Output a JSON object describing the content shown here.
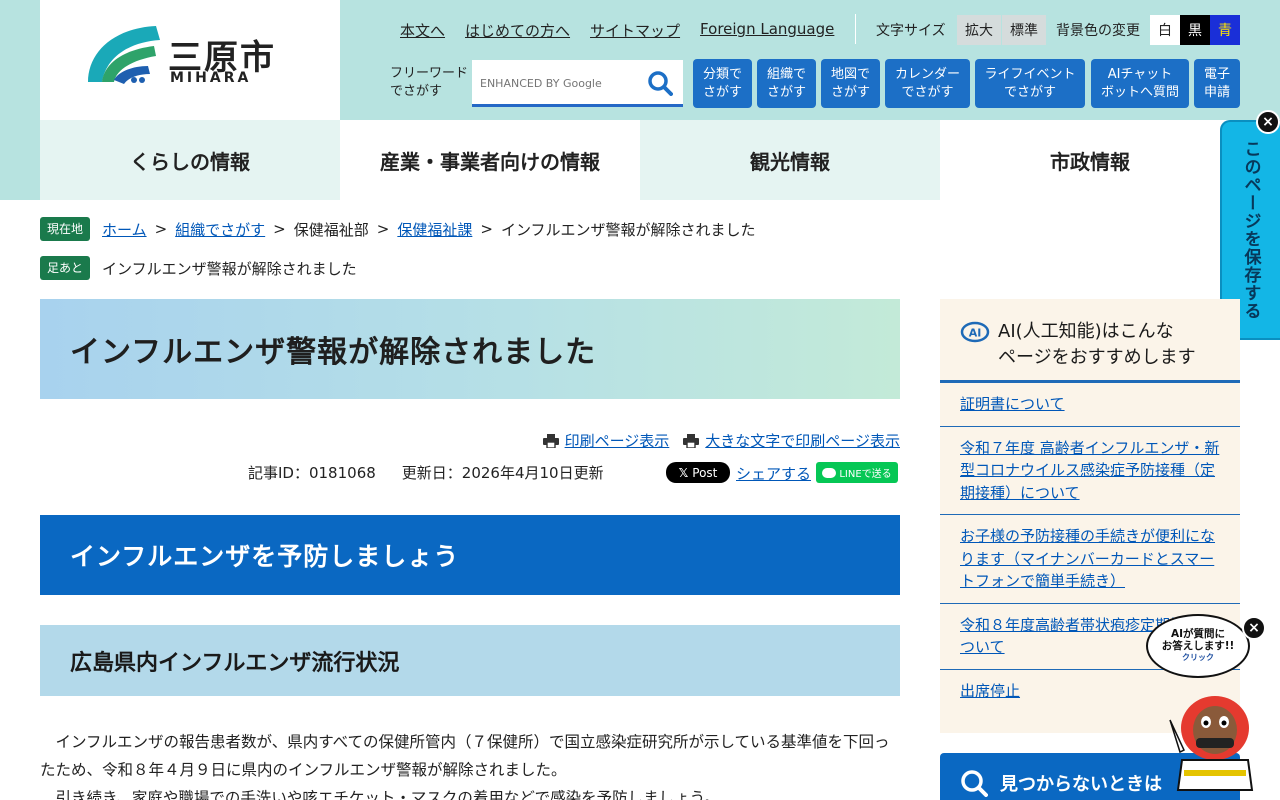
{
  "logo": {
    "name": "三原市",
    "sub": "MIHARA"
  },
  "top_links": [
    "本文へ",
    "はじめての方へ",
    "サイトマップ",
    "Foreign Language"
  ],
  "font_size": {
    "label": "文字サイズ",
    "larger": "拡大",
    "standard": "標準"
  },
  "bg_color": {
    "label": "背景色の変更",
    "white": "白",
    "black": "黒",
    "blue": "青"
  },
  "search": {
    "label": "フリーワード\nでさがす",
    "placeholder": "ENHANCED BY Google"
  },
  "nav_buttons": [
    "分類で\nさがす",
    "組織で\nさがす",
    "地図で\nさがす",
    "カレンダー\nでさがす",
    "ライフイベント\nでさがす",
    "AIチャット\nボットへ質問",
    "電子\n申請"
  ],
  "main_nav": [
    "くらしの情報",
    "産業・事業者向けの情報",
    "観光情報",
    "市政情報"
  ],
  "save_tab": "このページを保存する",
  "breadcrumb": {
    "badge": "現在地",
    "home": "ホーム",
    "org": "組織でさがす",
    "dept": "保健福祉部",
    "section": "保健福祉課",
    "current": "インフルエンザ警報が解除されました"
  },
  "footprint": {
    "badge": "足あと",
    "item": "インフルエンザ警報が解除されました"
  },
  "page": {
    "title": "インフルエンザ警報が解除されました",
    "print": "印刷ページ表示",
    "print_large": "大きな文字で印刷ページ表示",
    "article_id": "記事ID：0181068",
    "updated": "更新日：2026年4月10日更新",
    "x_post": "Post",
    "share": "シェアする",
    "line": "LINEで送る",
    "h2": "インフルエンザを予防しましょう",
    "h3": "広島県内インフルエンザ流行状況",
    "body1": "インフルエンザの報告患者数が、県内すべての保健所管内（７保健所）で国立感染症研究所が示している基準値を下回ったため、令和８年４月９日に県内のインフルエンザ警報が解除されました。",
    "body2": "引き続き、家庭や職場での手洗いや咳エチケット・マスクの着用などで感染を予防しましょう。"
  },
  "ai_reco": {
    "title": "AI(人工知能)はこんな\nページをおすすめします",
    "items": [
      "証明書について",
      "令和７年度 高齢者インフルエンザ・新型コロナウイルス感染症予防接種（定期接種）について",
      "お子様の予防接種の手続きが便利になります（マイナンバーカードとスマートフォンで簡単手続き）",
      "令和８年度高齢者帯状疱疹定期接種について",
      "出席停止"
    ]
  },
  "not_found": "見つからないときは",
  "mascot": {
    "line1": "AIが質問に",
    "line2": "お答えします!!",
    "click": "クリック"
  },
  "colors": {
    "header_bg": "#b7e3e0",
    "nav_button": "#1c6fc6",
    "h2_bg": "#0a68c2",
    "h3_bg": "#b3d9ea",
    "badge": "#1a7a4c",
    "save_tab": "#13b6e6",
    "link": "#0057b8"
  }
}
